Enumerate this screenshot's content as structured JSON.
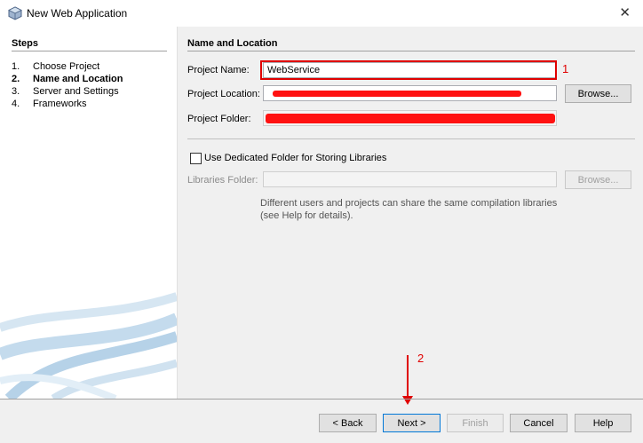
{
  "window": {
    "title": "New Web Application",
    "close_glyph": "✕"
  },
  "steps": {
    "heading": "Steps",
    "items": [
      {
        "num": "1.",
        "label": "Choose Project"
      },
      {
        "num": "2.",
        "label": "Name and Location"
      },
      {
        "num": "3.",
        "label": "Server and Settings"
      },
      {
        "num": "4.",
        "label": "Frameworks"
      }
    ]
  },
  "panel": {
    "heading": "Name and Location",
    "project_name": {
      "label": "Project Name:",
      "value": "WebService"
    },
    "project_location": {
      "label": "Project Location:",
      "value": ""
    },
    "project_folder": {
      "label": "Project Folder:",
      "value": ""
    },
    "browse_label": "Browse...",
    "dedicated_folder": {
      "label": "Use Dedicated Folder for Storing Libraries",
      "checked": false
    },
    "libraries_folder": {
      "label": "Libraries Folder:",
      "value": ""
    },
    "hint_line1": "Different users and projects can share the same compilation libraries",
    "hint_line2": "(see Help for details)."
  },
  "annotations": {
    "marker1": "1",
    "marker2": "2",
    "color": "#e00000"
  },
  "footer": {
    "back": "< Back",
    "next": "Next >",
    "finish": "Finish",
    "cancel": "Cancel",
    "help": "Help"
  }
}
